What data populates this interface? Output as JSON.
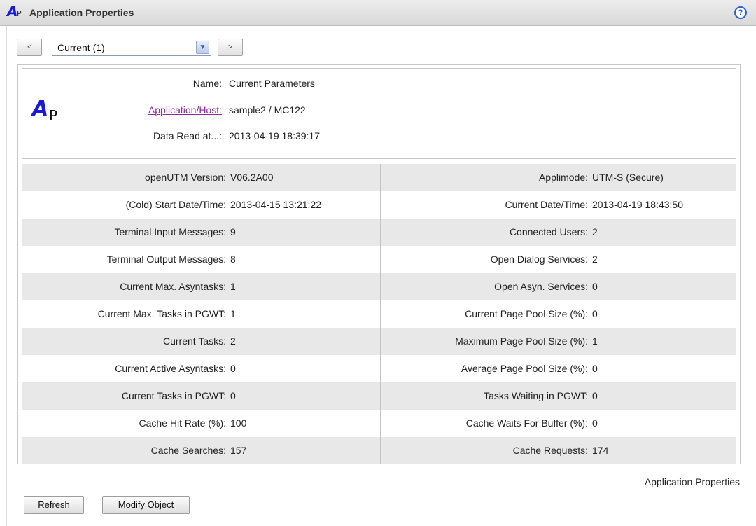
{
  "titlebar": {
    "logo_main": "A",
    "logo_sub": "P",
    "title": "Application Properties",
    "help_glyph": "?"
  },
  "nav": {
    "prev_label": "<",
    "next_label": ">",
    "select_value": "Current (1)"
  },
  "header": {
    "logo_main": "A",
    "logo_sub": "P",
    "name_label": "Name:",
    "name_value": "Current Parameters",
    "apphost_label": "Application/Host:",
    "apphost_value": "sample2 / MC122",
    "dataread_label": "Data Read at...:",
    "dataread_value": "2013-04-19 18:39:17"
  },
  "rows": [
    {
      "left_label": "openUTM Version:",
      "left_value": "V06.2A00",
      "right_label": "Applimode:",
      "right_value": "UTM-S (Secure)"
    },
    {
      "left_label": "(Cold) Start Date/Time:",
      "left_value": "2013-04-15 13:21:22",
      "right_label": "Current Date/Time:",
      "right_value": "2013-04-19 18:43:50"
    },
    {
      "left_label": "Terminal Input Messages:",
      "left_value": "9",
      "right_label": "Connected Users:",
      "right_value": "2"
    },
    {
      "left_label": "Terminal Output Messages:",
      "left_value": "8",
      "right_label": "Open Dialog Services:",
      "right_value": "2"
    },
    {
      "left_label": "Current Max. Asyntasks:",
      "left_value": "1",
      "right_label": "Open Asyn. Services:",
      "right_value": "0"
    },
    {
      "left_label": "Current Max. Tasks in PGWT:",
      "left_value": "1",
      "right_label": "Current Page Pool Size (%):",
      "right_value": "0"
    },
    {
      "left_label": "Current Tasks:",
      "left_value": "2",
      "right_label": "Maximum Page Pool Size (%):",
      "right_value": "1"
    },
    {
      "left_label": "Current Active Asyntasks:",
      "left_value": "0",
      "right_label": "Average Page Pool Size (%):",
      "right_value": "0"
    },
    {
      "left_label": "Current Tasks in PGWT:",
      "left_value": "0",
      "right_label": "Tasks Waiting in PGWT:",
      "right_value": "0"
    },
    {
      "left_label": "Cache Hit Rate (%):",
      "left_value": "100",
      "right_label": "Cache Waits For Buffer (%):",
      "right_value": "0"
    },
    {
      "left_label": "Cache Searches:",
      "left_value": "157",
      "right_label": "Cache Requests:",
      "right_value": "174"
    }
  ],
  "footer": {
    "caption": "Application Properties",
    "refresh_label": "Refresh",
    "modify_label": "Modify Object"
  }
}
